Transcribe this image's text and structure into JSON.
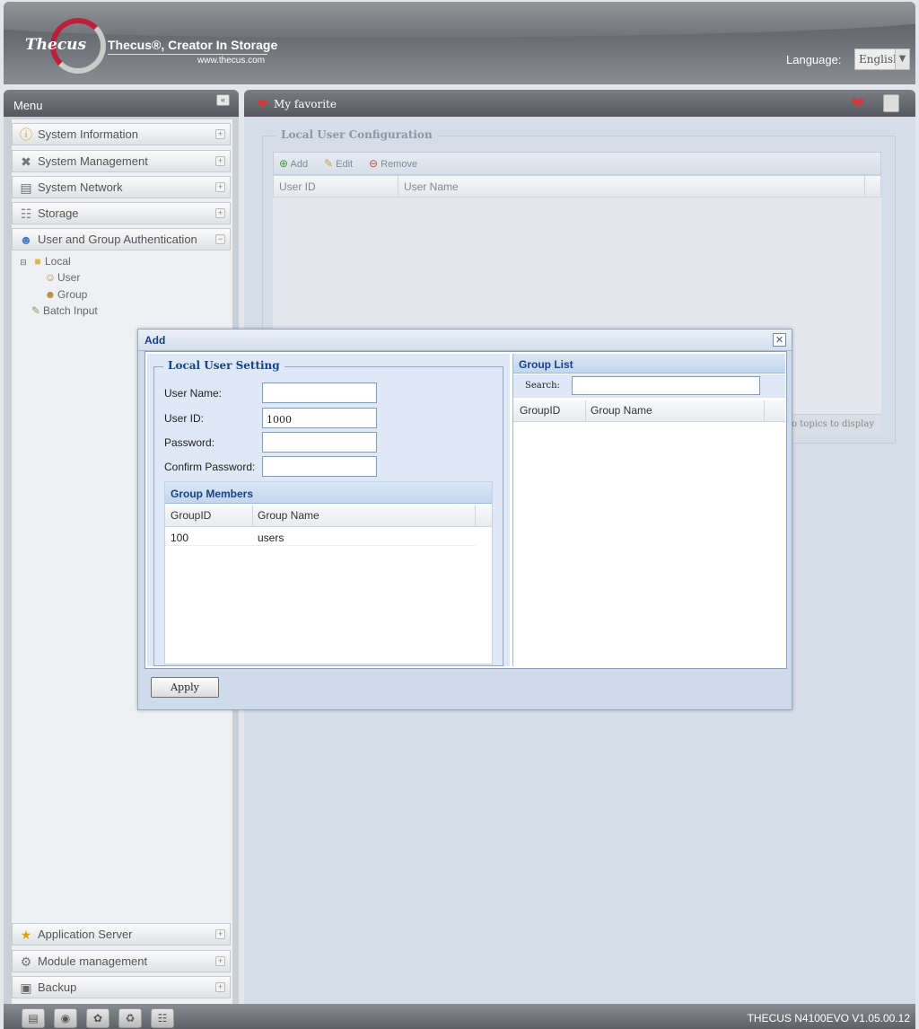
{
  "header": {
    "logo_text": "Thecus",
    "tagline": "Thecus®, Creator In Storage",
    "url": "www.thecus.com",
    "language_label": "Language:",
    "language_value": "English"
  },
  "menu": {
    "title": "Menu",
    "collapse_icon": "double-chevron-left-icon",
    "items_top": [
      {
        "label": "System Information",
        "icon": "info-icon"
      },
      {
        "label": "System Management",
        "icon": "tools-icon"
      },
      {
        "label": "System Network",
        "icon": "network-icon"
      },
      {
        "label": "Storage",
        "icon": "storage-icon"
      },
      {
        "label": "User and Group Authentication",
        "icon": "users-icon"
      }
    ],
    "tree": {
      "local": "Local",
      "user": "User",
      "group": "Group",
      "batch_input": "Batch Input"
    },
    "items_bottom": [
      {
        "label": "Application Server",
        "icon": "app-server-icon"
      },
      {
        "label": "Module management",
        "icon": "module-icon"
      },
      {
        "label": "Backup",
        "icon": "backup-icon"
      }
    ]
  },
  "content": {
    "favorite_label": "My favorite",
    "section_title": "Local User Configuration",
    "toolbar": {
      "add": "Add",
      "edit": "Edit",
      "remove": "Remove"
    },
    "columns": [
      "User ID",
      "User Name"
    ],
    "empty_text": "No topics to display"
  },
  "modal": {
    "title": "Add",
    "fieldset_title": "Local User Setting",
    "fields": {
      "user_name_label": "User Name:",
      "user_name_value": "",
      "user_id_label": "User ID:",
      "user_id_value": "1000",
      "password_label": "Password:",
      "confirm_password_label": "Confirm Password:"
    },
    "group_members": {
      "title": "Group Members",
      "columns": [
        "GroupID",
        "Group Name"
      ],
      "rows": [
        {
          "group_id": "100",
          "group_name": "users"
        }
      ]
    },
    "group_list": {
      "title": "Group List",
      "search_label": "Search:",
      "columns": [
        "GroupID",
        "Group Name"
      ]
    },
    "apply_label": "Apply"
  },
  "statusbar": {
    "version": "THECUS N4100EVO V1.05.00.12"
  }
}
